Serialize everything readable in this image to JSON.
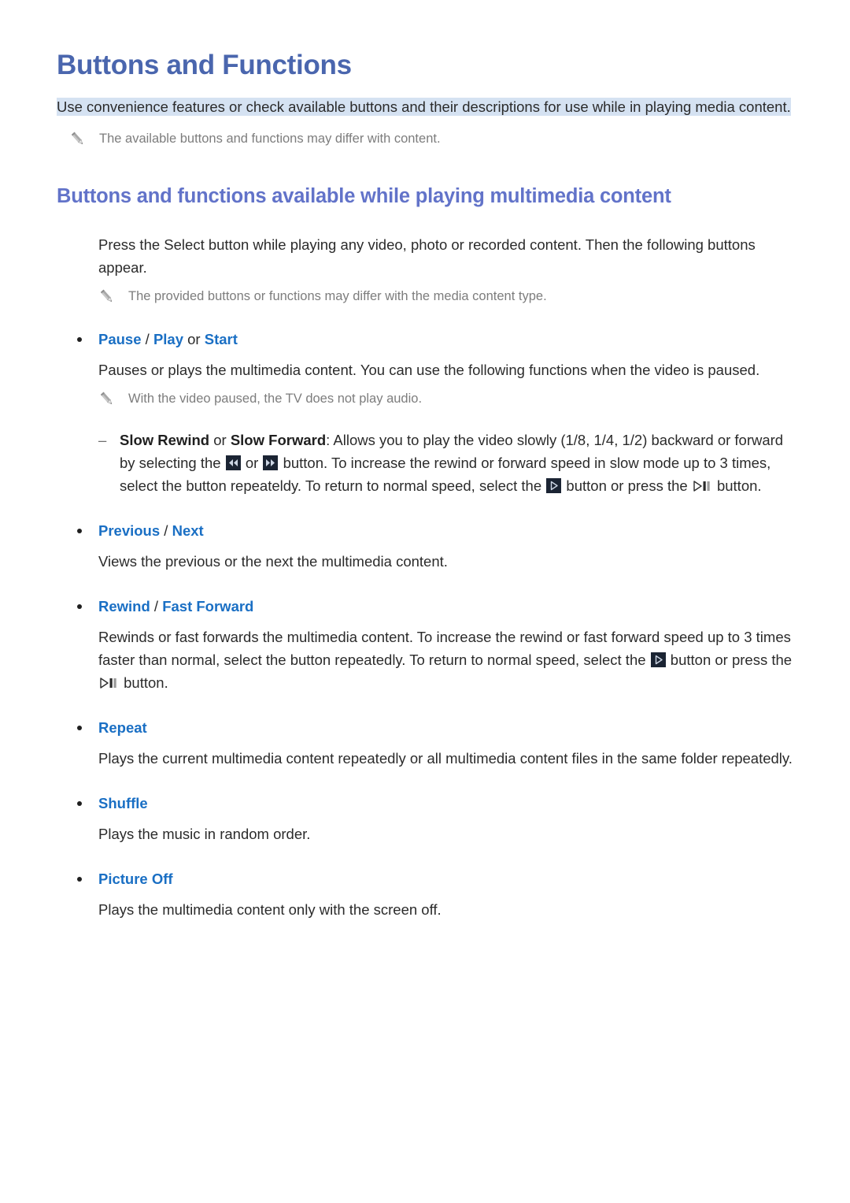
{
  "page": {
    "title": "Buttons and Functions",
    "lead": "Use convenience features or check available buttons and their descriptions for use while in playing media content.",
    "lead_note": "The available buttons and functions may differ with content.",
    "section_heading": "Buttons and functions available while playing multimedia content",
    "section_intro": "Press the Select button while playing any video, photo or recorded content. Then the following buttons appear.",
    "section_note": "The provided buttons or functions may differ with the media content type."
  },
  "colors": {
    "title_blue": "#4a66ae",
    "heading_blue": "#6273c9",
    "bullet_blue": "#1a6fc4",
    "highlight_bg": "#d5e2f2",
    "note_gray": "#7d7d7d",
    "body_text": "#2b2b2b",
    "glyph_box": "#1b2433"
  },
  "icons": {
    "note": "pencil-icon",
    "slow_rewind": "rewind-button-icon",
    "slow_forward": "fast-forward-button-icon",
    "play": "play-button-icon",
    "play_pause": "play-pause-button-icon"
  },
  "bullets": [
    {
      "id": "pause-play-start",
      "head_parts": [
        {
          "text": "Pause",
          "style": "blue"
        },
        {
          "text": " / ",
          "style": "plain"
        },
        {
          "text": "Play",
          "style": "blue"
        },
        {
          "text": " or ",
          "style": "plain"
        },
        {
          "text": "Start",
          "style": "blue"
        }
      ],
      "body": "Pauses or plays the multimedia content. You can use the following functions when the video is paused.",
      "note": "With the video paused, the TV does not play audio.",
      "sub_item": {
        "label_a": "Slow Rewind",
        "label_or": " or ",
        "label_b": "Slow Forward",
        "text_1": ": Allows you to play the video slowly (1/8, 1/4, 1/2) backward or forward by selecting the ",
        "text_2": " or ",
        "text_3": " button. To increase the rewind or forward speed in slow mode up to 3 times, select the button repeateldy. To return to normal speed, select the ",
        "text_4": " button or press the ",
        "text_5": " button."
      }
    },
    {
      "id": "previous-next",
      "head_parts": [
        {
          "text": "Previous",
          "style": "blue"
        },
        {
          "text": " / ",
          "style": "plain"
        },
        {
          "text": "Next",
          "style": "blue"
        }
      ],
      "body": "Views the previous or the next the multimedia content."
    },
    {
      "id": "rewind-fast-forward",
      "head_parts": [
        {
          "text": "Rewind",
          "style": "blue"
        },
        {
          "text": " / ",
          "style": "plain"
        },
        {
          "text": "Fast Forward",
          "style": "blue"
        }
      ],
      "body_parts": {
        "text_1": "Rewinds or fast forwards the multimedia content. To increase the rewind or fast forward speed up to 3 times faster than normal, select the button repeatedly. To return to normal speed, select the ",
        "text_2": " button or press the ",
        "text_3": " button."
      }
    },
    {
      "id": "repeat",
      "head_parts": [
        {
          "text": "Repeat",
          "style": "blue"
        }
      ],
      "body": "Plays the current multimedia content repeatedly or all multimedia content files in the same folder repeatedly."
    },
    {
      "id": "shuffle",
      "head_parts": [
        {
          "text": "Shuffle",
          "style": "blue"
        }
      ],
      "body": "Plays the music in random order."
    },
    {
      "id": "picture-off",
      "head_parts": [
        {
          "text": "Picture Off",
          "style": "blue"
        }
      ],
      "body": "Plays the multimedia content only with the screen off."
    }
  ]
}
